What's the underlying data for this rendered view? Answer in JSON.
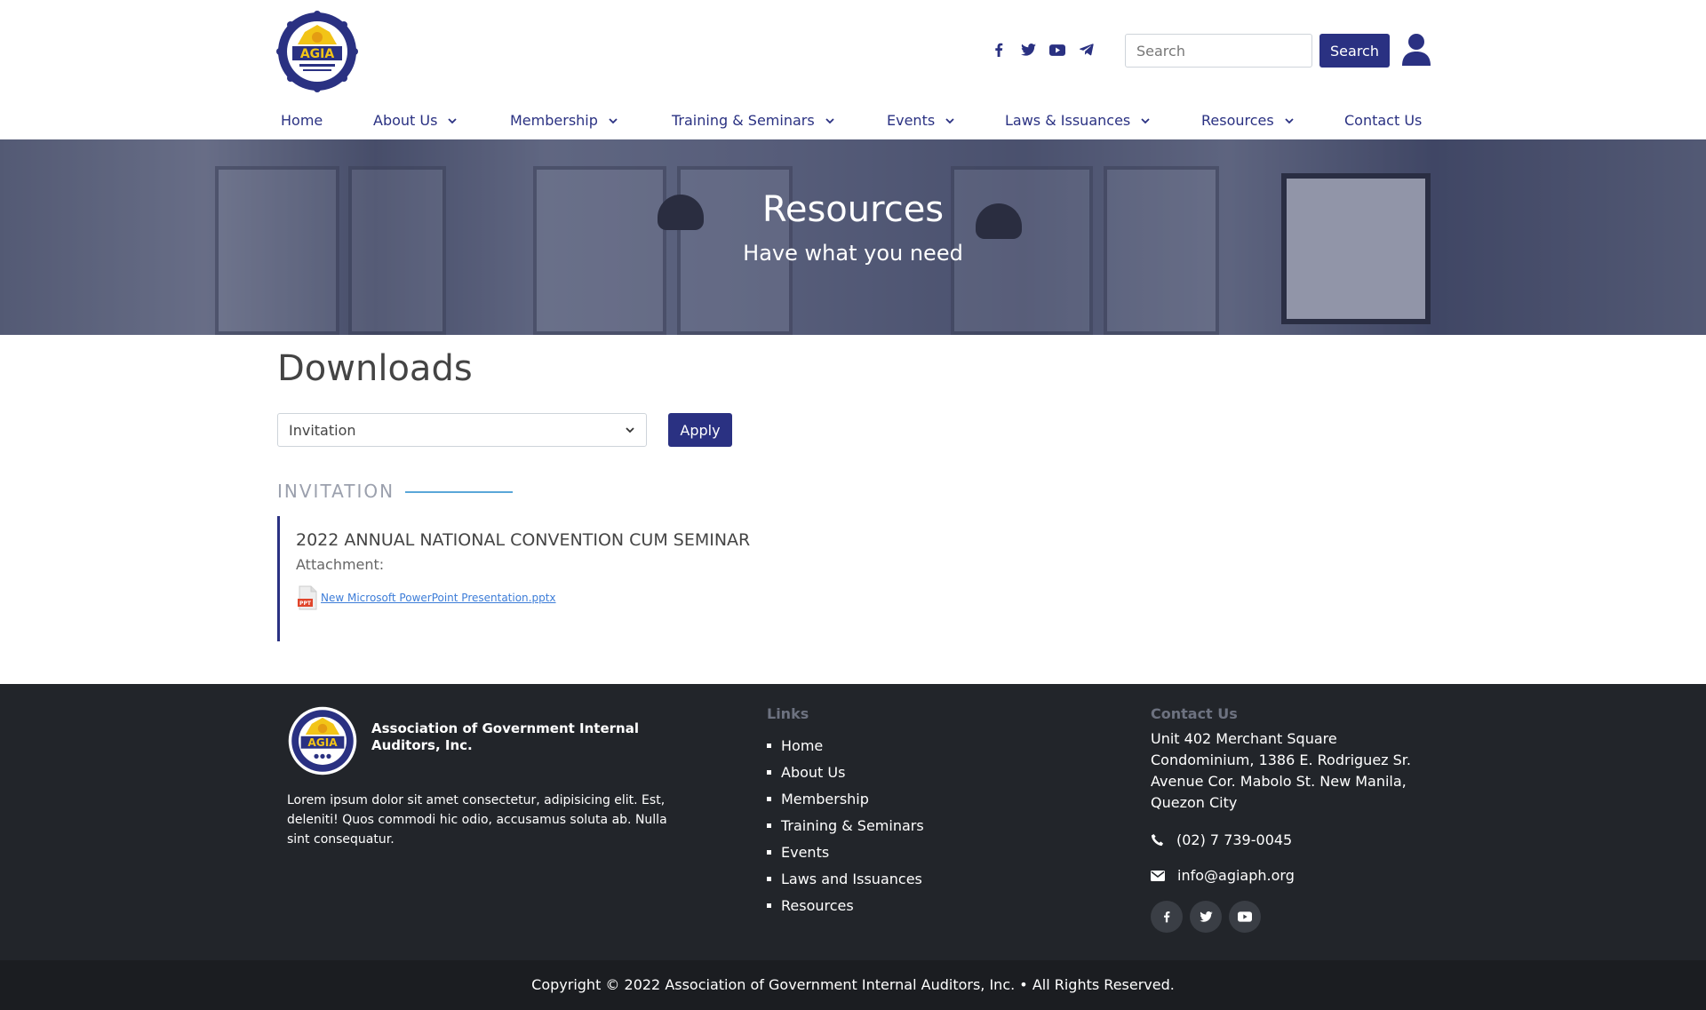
{
  "header": {
    "logo_text": "AGIA",
    "search": {
      "placeholder": "Search",
      "button_label": "Search"
    },
    "social_icons": [
      "facebook-icon",
      "twitter-icon",
      "youtube-icon",
      "telegram-icon"
    ]
  },
  "nav": {
    "items": [
      {
        "label": "Home",
        "dropdown": false
      },
      {
        "label": "About Us",
        "dropdown": true
      },
      {
        "label": "Membership",
        "dropdown": true
      },
      {
        "label": "Training & Seminars",
        "dropdown": true
      },
      {
        "label": "Events",
        "dropdown": true
      },
      {
        "label": "Laws & Issuances",
        "dropdown": true
      },
      {
        "label": "Resources",
        "dropdown": true
      },
      {
        "label": "Contact Us",
        "dropdown": false
      }
    ]
  },
  "hero": {
    "title": "Resources",
    "subtitle": "Have what you need"
  },
  "main": {
    "page_title": "Downloads",
    "filter": {
      "selected": "Invitation",
      "apply_label": "Apply"
    },
    "section_label": "INVITATION",
    "items": [
      {
        "title": "2022 ANNUAL NATIONAL CONVENTION CUM SEMINAR",
        "attachment_label": "Attachment:",
        "file_name": "New Microsoft PowerPoint Presentation.pptx",
        "file_badge": "PPT"
      }
    ]
  },
  "footer": {
    "org_name": "Association of Government Internal Auditors, Inc.",
    "description": "Lorem ipsum dolor sit amet consectetur, adipisicing elit. Est, deleniti! Quos commodi hic odio, accusamus soluta ab. Nulla sint consequatur.",
    "links_title": "Links",
    "links": [
      "Home",
      "About Us",
      "Membership",
      "Training & Seminars",
      "Events",
      "Laws and Issuances",
      "Resources"
    ],
    "contact_title": "Contact Us",
    "address": "Unit 402 Merchant Square Condominium, 1386 E. Rodriguez Sr. Avenue Cor. Mabolo St. New Manila, Quezon City",
    "phone": "(02) 7 739-0045",
    "email": "info@agiaph.org",
    "social_icons": [
      "facebook-icon",
      "twitter-icon",
      "youtube-icon"
    ]
  },
  "copyright": "Copyright © 2022 Association of Government Internal Auditors, Inc. • All Rights Reserved.",
  "colors": {
    "brand": "#2a3182",
    "footer_bg": "#22252a",
    "accent_line": "#5aa7d8",
    "link": "#3d7dd8"
  }
}
